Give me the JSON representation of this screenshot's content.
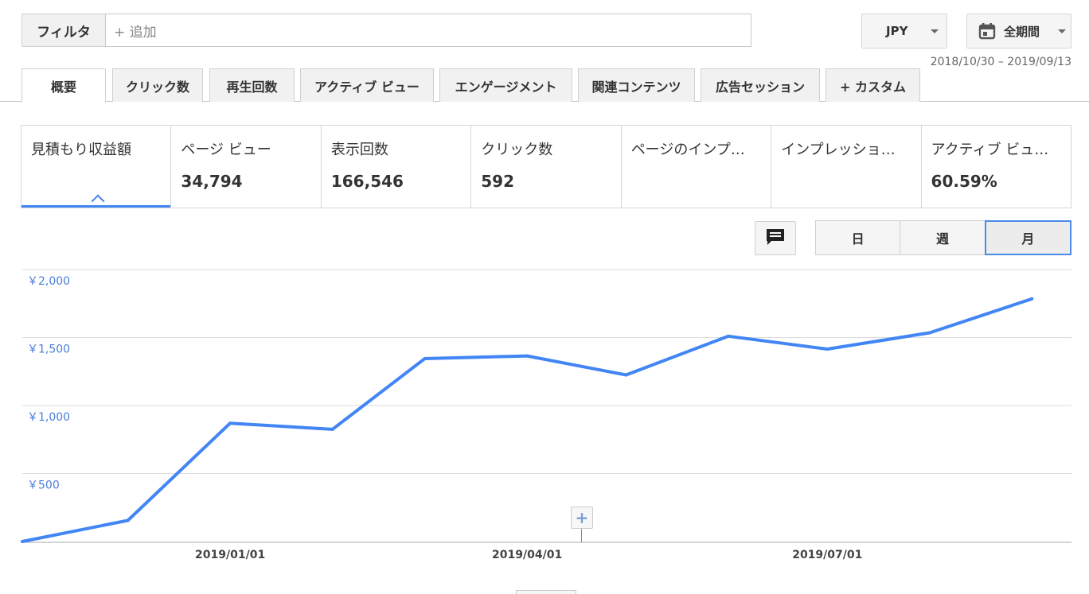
{
  "filter": {
    "label": "フィルタ",
    "placeholder": "+ 追加"
  },
  "currency": {
    "value": "JPY"
  },
  "period": {
    "label": "全期間",
    "range": "2018/10/30 – 2019/09/13"
  },
  "tabs": [
    {
      "label": "概要",
      "active": true
    },
    {
      "label": "クリック数"
    },
    {
      "label": "再生回数"
    },
    {
      "label": "アクティブ ビュー"
    },
    {
      "label": "エンゲージメント"
    },
    {
      "label": "関連コンテンツ"
    },
    {
      "label": "広告セッション"
    },
    {
      "label": "+ カスタム"
    }
  ],
  "metrics": [
    {
      "label": "見積もり収益額",
      "value": "",
      "selected": true
    },
    {
      "label": "ページ ビュー",
      "value": "34,794"
    },
    {
      "label": "表示回数",
      "value": "166,546"
    },
    {
      "label": "クリック数",
      "value": "592"
    },
    {
      "label": "ページのインプ…",
      "value": ""
    },
    {
      "label": "インプレッショ…",
      "value": ""
    },
    {
      "label": "アクティブ ビュ…",
      "value": "60.59%"
    }
  ],
  "granularity": {
    "day": "日",
    "week": "週",
    "month": "月",
    "selected": "month"
  },
  "icons": {
    "annotation": "comment-icon",
    "calendar": "calendar-icon",
    "add": "plus-icon"
  },
  "colors": {
    "line": "#4285f4",
    "ytick": "#4a7ed8",
    "accent": "#4285f4"
  },
  "chart_data": {
    "type": "line",
    "title": "",
    "xlabel": "",
    "ylabel": "",
    "x": [
      "2018-10-30",
      "2018-12-01",
      "2019-01-01",
      "2019-02-01",
      "2019-03-01",
      "2019-04-01",
      "2019-05-01",
      "2019-06-01",
      "2019-07-01",
      "2019-08-01",
      "2019-09-01"
    ],
    "series": [
      {
        "values": [
          0,
          155,
          870,
          825,
          1345,
          1365,
          1225,
          1510,
          1415,
          1535,
          1785
        ]
      }
    ],
    "ylim": [
      0,
      2000
    ],
    "yticks": [
      500,
      1000,
      1500,
      2000
    ],
    "ytick_labels": [
      "￥500",
      "￥1,000",
      "￥1,500",
      "￥2,000"
    ],
    "xticks": [
      "2019-01-01",
      "2019-04-01",
      "2019-07-01"
    ],
    "xtick_labels": [
      "2019/01/01",
      "2019/04/01",
      "2019/07/01"
    ],
    "grid": true,
    "legend": "none"
  }
}
